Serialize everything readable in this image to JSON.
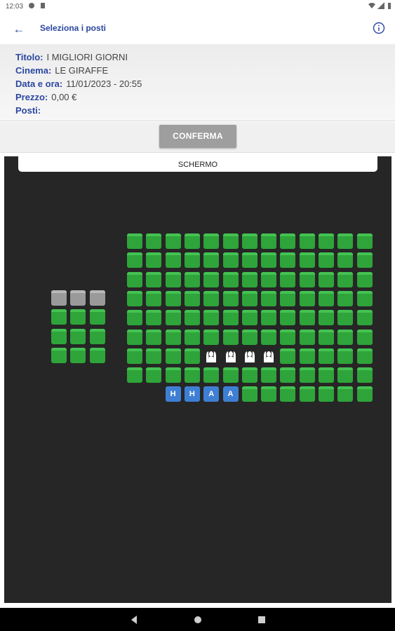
{
  "status_bar": {
    "time": "12:03"
  },
  "app_bar": {
    "title": "Seleziona i posti"
  },
  "booking": {
    "title_label": "Titolo:",
    "title_value": "I MIGLIORI GIORNI",
    "cinema_label": "Cinema:",
    "cinema_value": "LE GIRAFFE",
    "date_label": "Data e ora:",
    "date_value": "11/01/2023 - 20:55",
    "price_label": "Prezzo:",
    "price_value": "0,00 €",
    "seats_label": "Posti:",
    "seats_value": ""
  },
  "confirm_label": "CONFERMA",
  "screen_label": "SCHERMO",
  "seating": {
    "left_block": [
      [
        "unavailable",
        "unavailable",
        "unavailable"
      ],
      [
        "free",
        "free",
        "free"
      ],
      [
        "free",
        "free",
        "free"
      ],
      [
        "free",
        "free",
        "free"
      ]
    ],
    "main_block": [
      [
        "free",
        "free",
        "free",
        "free",
        "free",
        "free",
        "free",
        "free",
        "free",
        "free",
        "free",
        "free",
        "free"
      ],
      [
        "free",
        "free",
        "free",
        "free",
        "free",
        "free",
        "free",
        "free",
        "free",
        "free",
        "free",
        "free",
        "free"
      ],
      [
        "free",
        "free",
        "free",
        "free",
        "free",
        "free",
        "free",
        "free",
        "free",
        "free",
        "free",
        "free",
        "free"
      ],
      [
        "free",
        "free",
        "free",
        "free",
        "free",
        "free",
        "free",
        "free",
        "free",
        "free",
        "free",
        "free",
        "free"
      ],
      [
        "free",
        "free",
        "free",
        "free",
        "free",
        "free",
        "free",
        "free",
        "free",
        "free",
        "free",
        "free",
        "free"
      ],
      [
        "free",
        "free",
        "free",
        "free",
        "free",
        "free",
        "free",
        "free",
        "free",
        "free",
        "free",
        "free",
        "free"
      ],
      [
        "free",
        "free",
        "free",
        "free",
        "occupied",
        "occupied",
        "occupied",
        "occupied",
        "free",
        "free",
        "free",
        "free",
        "free"
      ],
      [
        "free",
        "free",
        "free",
        "free",
        "free",
        "free",
        "free",
        "free",
        "free",
        "free",
        "free",
        "free",
        "free"
      ],
      [
        "empty",
        "empty",
        "H",
        "H",
        "A",
        "A",
        "free",
        "free",
        "free",
        "free",
        "free",
        "free",
        "free"
      ]
    ]
  },
  "colors": {
    "free": "#2ea43a",
    "unavailable": "#9a9a9a",
    "accessible": "#3e7fd4",
    "background": "#262626",
    "accent": "#2a46a0"
  }
}
